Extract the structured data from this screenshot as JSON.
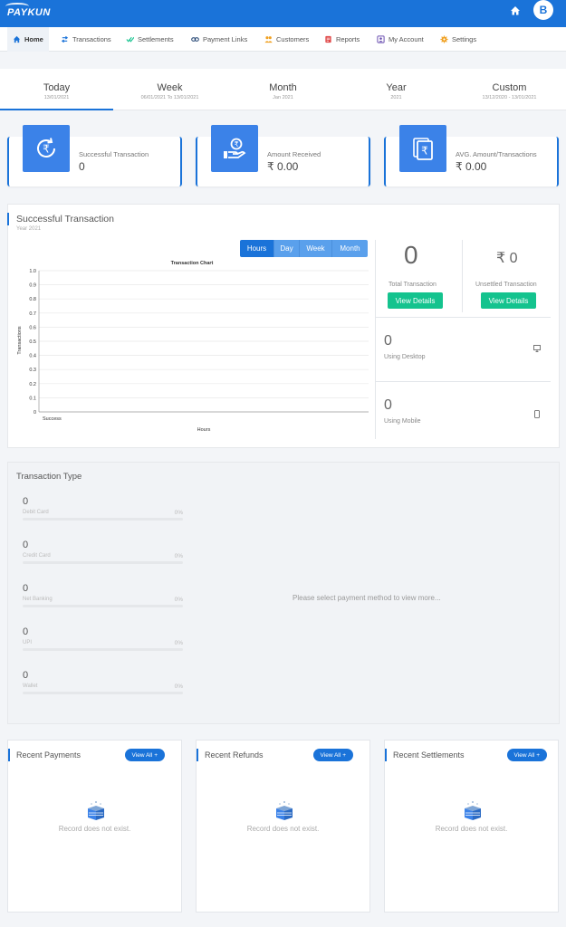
{
  "brand": {
    "logo": "PAYKUN",
    "user_initial": "B"
  },
  "nav": [
    {
      "label": "Home",
      "icon": "home-icon",
      "color": "#1a73d9"
    },
    {
      "label": "Transactions",
      "icon": "transactions-icon",
      "color": "#1a73d9"
    },
    {
      "label": "Settlements",
      "icon": "settlements-icon",
      "color": "#14c38e"
    },
    {
      "label": "Payment Links",
      "icon": "link-icon",
      "color": "#1a3d6d"
    },
    {
      "label": "Customers",
      "icon": "customers-icon",
      "color": "#f0a020"
    },
    {
      "label": "Reports",
      "icon": "reports-icon",
      "color": "#e04a4a"
    },
    {
      "label": "My Account",
      "icon": "account-icon",
      "color": "#6a4fb0"
    },
    {
      "label": "Settings",
      "icon": "gear-icon",
      "color": "#f0a020"
    }
  ],
  "periods": [
    {
      "label": "Today",
      "sub": "13/01/2021",
      "active": true
    },
    {
      "label": "Week",
      "sub": "06/01/2021 To 13/01/2021"
    },
    {
      "label": "Month",
      "sub": "Jan 2021"
    },
    {
      "label": "Year",
      "sub": "2021"
    },
    {
      "label": "Custom",
      "sub": "13/12/2020 - 13/01/2021"
    }
  ],
  "stats": [
    {
      "label": "Successful Transaction",
      "value": "0",
      "icon": "rupee-refresh-icon"
    },
    {
      "label": "Amount Received",
      "value": "₹ 0.00",
      "icon": "hand-rupee-icon"
    },
    {
      "label": "AVG. Amount/Transactions",
      "value": "₹ 0.00",
      "icon": "rupee-notes-icon"
    }
  ],
  "success_panel": {
    "title": "Successful Transaction",
    "subtitle": "Year 2021",
    "chart_buttons": [
      "Hours",
      "Day",
      "Week",
      "Month"
    ],
    "total_value": "0",
    "total_label": "Total Transaction",
    "unsettled_value": "₹ 0",
    "unsettled_label": "Unsettled Transaction",
    "view_details": "View Details",
    "desktop_value": "0",
    "desktop_label": "Using Desktop",
    "mobile_value": "0",
    "mobile_label": "Using Mobile"
  },
  "chart_data": {
    "type": "bar",
    "title": "Transaction Chart",
    "xlabel": "Hours",
    "ylabel": "Transactions",
    "categories": [
      "Success"
    ],
    "values": [
      0
    ],
    "ylim": [
      0,
      1
    ],
    "yticks": [
      "0",
      "0.1",
      "0.2",
      "0.3",
      "0.4",
      "0.5",
      "0.6",
      "0.7",
      "0.8",
      "0.9",
      "1.0"
    ],
    "grid": true
  },
  "transaction_type": {
    "title": "Transaction Type",
    "message": "Please select payment method to view more...",
    "items": [
      {
        "value": "0",
        "name": "Debit Card",
        "pct": "0%"
      },
      {
        "value": "0",
        "name": "Credit Card",
        "pct": "0%"
      },
      {
        "value": "0",
        "name": "Net Banking",
        "pct": "0%"
      },
      {
        "value": "0",
        "name": "UPI",
        "pct": "0%"
      },
      {
        "value": "0",
        "name": "Wallet",
        "pct": "0%"
      }
    ]
  },
  "recent": [
    {
      "title": "Recent Payments",
      "button": "View All",
      "empty": "Record does not exist."
    },
    {
      "title": "Recent Refunds",
      "button": "View All",
      "empty": "Record does not exist."
    },
    {
      "title": "Recent Settlements",
      "button": "View All",
      "empty": "Record does not exist."
    }
  ]
}
